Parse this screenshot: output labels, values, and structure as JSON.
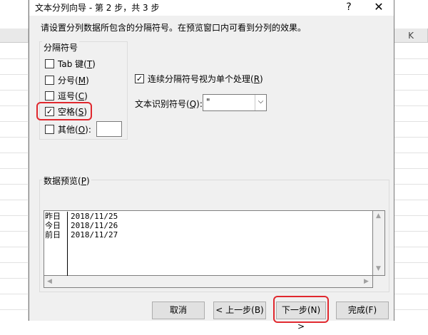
{
  "spreadsheet": {
    "visible_column_letter": "K"
  },
  "dialog": {
    "title": "文本分列向导 - 第 2 步，共 3 步",
    "help_label": "?",
    "close_label": "✕",
    "instruction": "请设置分列数据所包含的分隔符号。在预览窗口内可看到分列的效果。",
    "delimiters_group": {
      "title": "分隔符号",
      "items": [
        {
          "label": "Tab 键",
          "key": "T",
          "checked": false
        },
        {
          "label": "分号",
          "key": "M",
          "checked": false
        },
        {
          "label": "逗号",
          "key": "C",
          "checked": false
        },
        {
          "label": "空格",
          "key": "S",
          "checked": true
        },
        {
          "label": "其他",
          "key": "O",
          "checked": false
        }
      ]
    },
    "consecutive_delimiters": {
      "label": "连续分隔符号视为单个处理",
      "key": "R",
      "checked": true
    },
    "text_qualifier": {
      "label": "文本识别符号",
      "key": "Q",
      "value": "\""
    },
    "preview": {
      "title": "数据预览",
      "key": "P",
      "column1": [
        "昨日",
        "今日",
        "前日"
      ],
      "column2": [
        "2018/11/25",
        "2018/11/26",
        "2018/11/27"
      ]
    },
    "buttons": {
      "cancel": "取消",
      "back": "< 上一步(B)",
      "next": "下一步(N) >",
      "finish": "完成(F)"
    }
  },
  "highlight_color": "#e0282e"
}
